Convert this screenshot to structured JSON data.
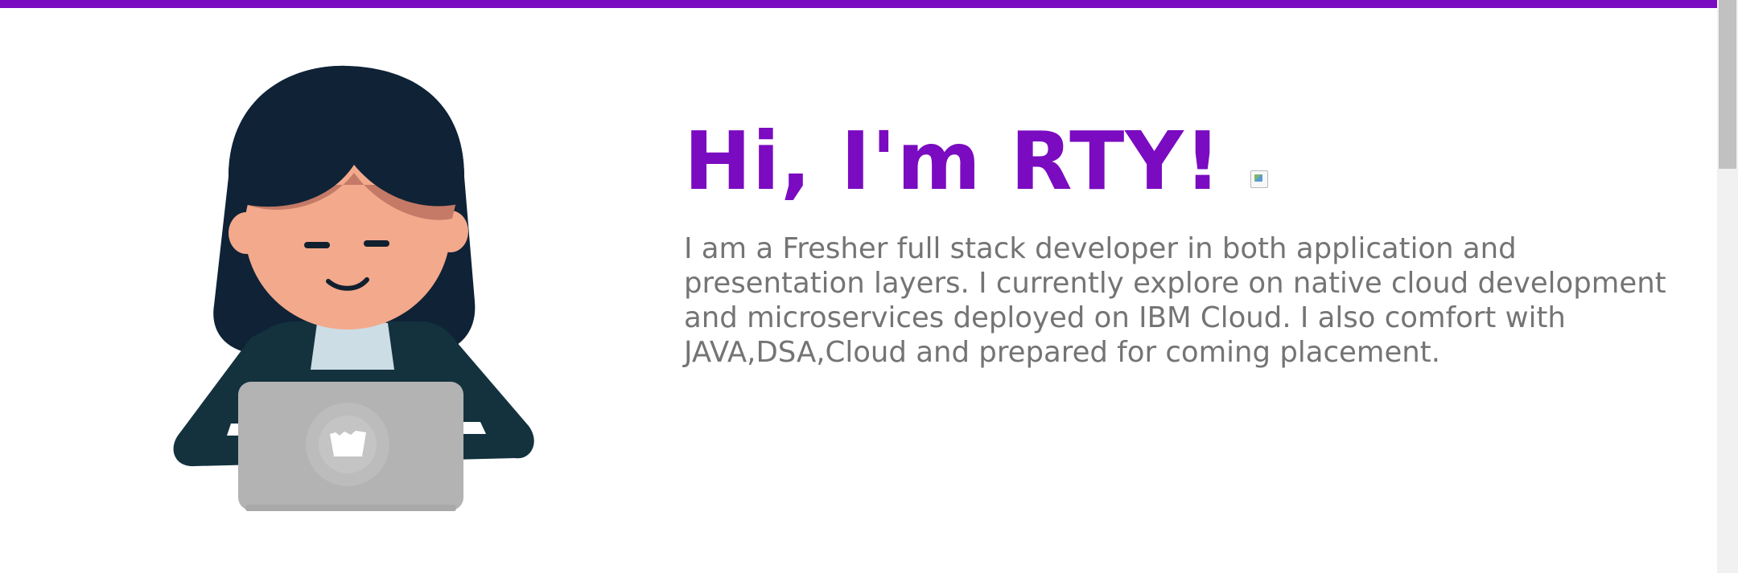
{
  "hero": {
    "title": "Hi, I'm RTY!",
    "wave_icon": "broken-image-icon",
    "intro": "I am a Fresher full stack developer in both application and presentation layers. I currently explore on native cloud development and microservices deployed on IBM Cloud. I also comfort with JAVA,DSA,Cloud and prepared for coming placement."
  },
  "illustration": {
    "subject": "developer-with-laptop",
    "laptop_logo": "briefcase-icon"
  },
  "colors": {
    "accent": "#7a0bc0",
    "text": "#747474",
    "hair": "#0f2236",
    "skin": "#f3a98c",
    "jacket": "#13323e",
    "laptop": "#b3b3b3"
  }
}
